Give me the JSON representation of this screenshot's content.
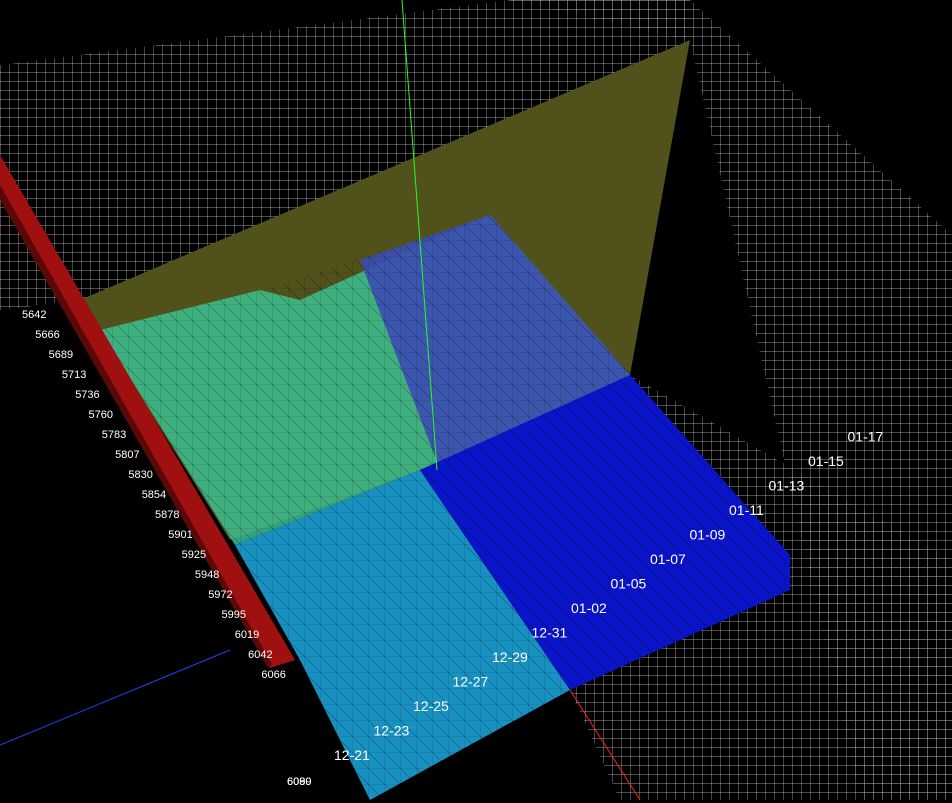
{
  "chart_data": {
    "type": "surface",
    "colors": {
      "background": "#000000",
      "grid": "#c8c8c8",
      "surface_low": "#0a14c8",
      "surface_mid": "#1890c0",
      "surface_high": "#3cc090",
      "cutting_plane": "#b4b43c",
      "side_slab": "#a01010",
      "x_axis": "#ff2020",
      "y_axis": "#20ff20",
      "z_axis": "#2040ff"
    },
    "grid": true,
    "depth_axis": {
      "tick_labels": [
        "5642",
        "5666",
        "5689",
        "5713",
        "5736",
        "5760",
        "5783",
        "5807",
        "5830",
        "5854",
        "5878",
        "5901",
        "5925",
        "5948",
        "5972",
        "5995",
        "6019",
        "6042",
        "6066",
        "6089",
        "6090"
      ]
    },
    "date_axis": {
      "tick_labels": [
        "12-21",
        "12-23",
        "12-25",
        "12-27",
        "12-29",
        "12-31",
        "01-02",
        "01-05",
        "01-07",
        "01-09",
        "01-11",
        "01-13",
        "01-15",
        "01-17"
      ]
    }
  }
}
